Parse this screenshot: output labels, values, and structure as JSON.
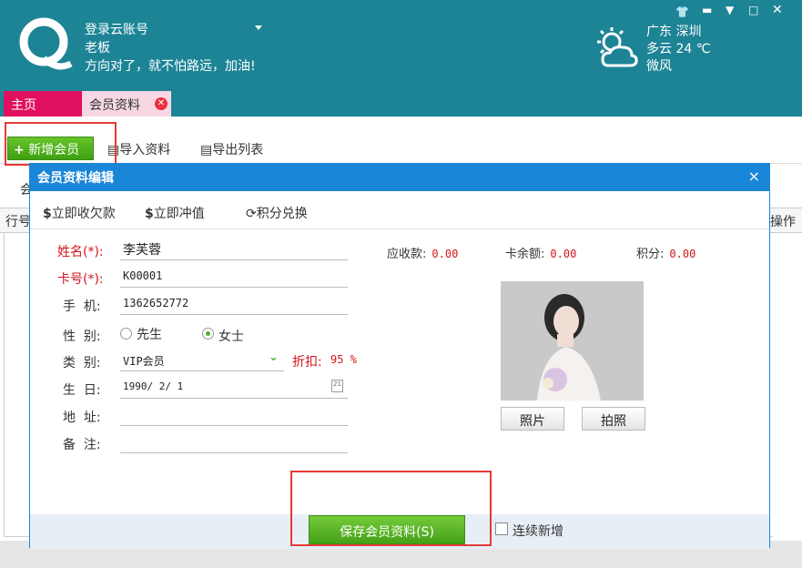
{
  "header": {
    "account_label": "登录云账号",
    "user_name": "老板",
    "slogan": "方向对了，就不怕路远，加油!",
    "window_controls": [
      "shirt-icon",
      "minimize-icon",
      "dropdown-icon",
      "maximize-icon",
      "close-icon"
    ],
    "weather": {
      "location": "广东 深圳",
      "condition_temp": "多云 24 ℃",
      "wind": "微风"
    }
  },
  "tabs": [
    {
      "label": "主页",
      "active": false
    },
    {
      "label": "会员资料",
      "active": true
    }
  ],
  "toolbar": {
    "add_member": "新增会员",
    "import": "导入资料",
    "export": "导出列表"
  },
  "grid": {
    "col_first": "行号",
    "col_last": "操作",
    "partial_label": "会"
  },
  "dialog": {
    "title": "会员资料编辑",
    "close": "×",
    "tools": {
      "collect_debt": "立即收欠款",
      "recharge": "立即冲值",
      "points_exchange": "积分兑换"
    },
    "form": {
      "name_label": "姓名(*):",
      "name_value": "李芙蓉",
      "card_label": "卡号(*):",
      "card_value": "K00001",
      "phone_label": "手  机:",
      "phone_value": "1362652772",
      "gender_label": "性  别:",
      "gender_male": "先生",
      "gender_female": "女士",
      "type_label": "类  别:",
      "type_value": "VIP会员",
      "discount_label": "折扣:",
      "discount_value": "95 %",
      "birthday_label": "生  日:",
      "birthday_value": "1990/ 2/ 1",
      "address_label": "地  址:",
      "address_value": "",
      "note_label": "备  注:",
      "note_value": ""
    },
    "stats": {
      "receivable_label": "应收款:",
      "receivable_value": "0.00",
      "balance_label": "卡余额:",
      "balance_value": "0.00",
      "points_label": "积分:",
      "points_value": "0.00"
    },
    "photo_button": "照片",
    "camera_button": "拍照",
    "save_button": "保存会员资料(S)",
    "continue_add": "连续新增"
  },
  "colors": {
    "header_bg": "#1d8496",
    "home_tab": "#e0115f",
    "dialog_blue": "#1a86d8",
    "green": "#4bae2a",
    "required_red": "#d2151b"
  }
}
